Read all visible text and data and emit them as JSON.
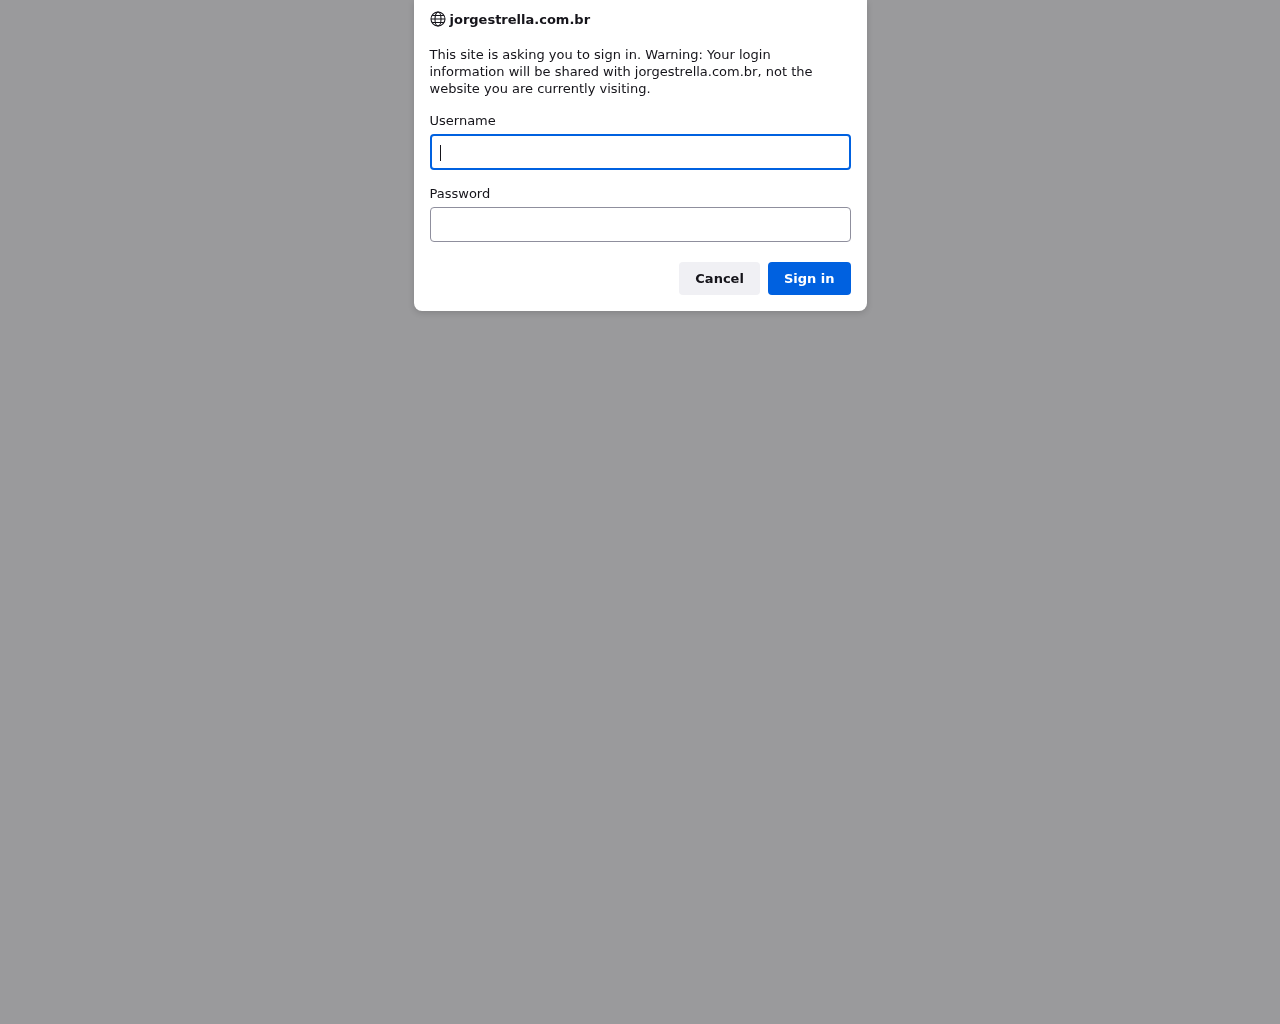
{
  "dialog": {
    "site": "jorgestrella.com.br",
    "message": "This site is asking you to sign in. Warning: Your login information will be shared with jorgestrella.com.br, not the website you are currently visiting.",
    "fields": [
      {
        "label": "Username",
        "focused": true
      },
      {
        "label": "Password",
        "focused": false
      }
    ],
    "buttons": [
      {
        "label": "Cancel",
        "kind": "secondary"
      },
      {
        "label": "Sign in",
        "kind": "primary"
      }
    ]
  }
}
